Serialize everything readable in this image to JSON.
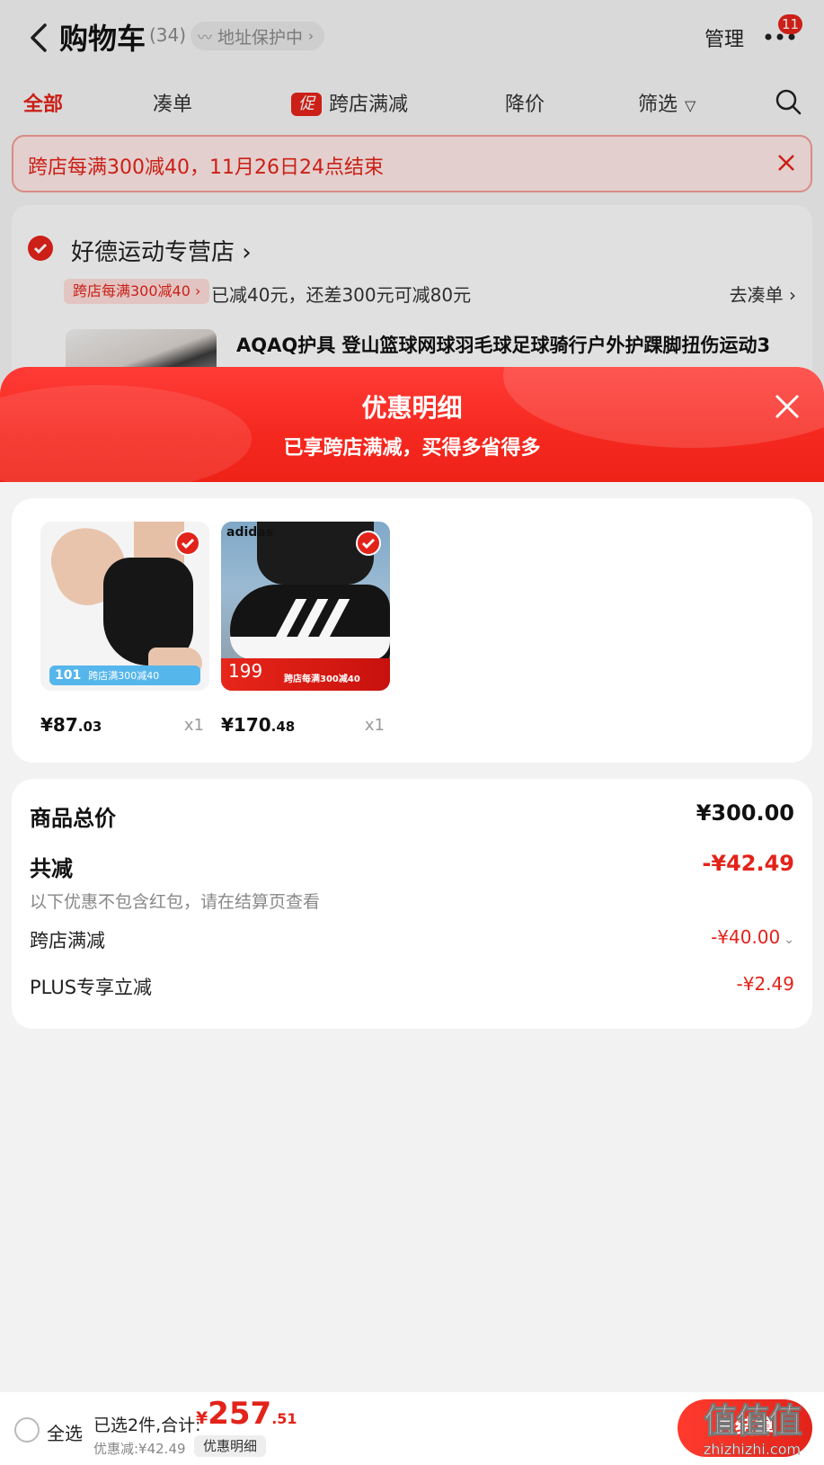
{
  "header": {
    "title": "购物车",
    "count": "(34)",
    "address_label": "地址保护中",
    "manage_label": "管理",
    "more_badge": "11"
  },
  "tabs": {
    "all": "全部",
    "combine": "凑单",
    "promo_icon": "促",
    "cross_store": "跨店满减",
    "price_drop": "降价",
    "filter": "筛选"
  },
  "promo_banner": {
    "text": "跨店每满300减40，11月26日24点结束"
  },
  "store": {
    "name": "好德运动专营店",
    "promo_tag": "跨店每满300减40",
    "promo_desc": "已减40元，还差300元可减80元",
    "goto_label": "去凑单",
    "product_title": "AQAQ护具 登山篮球网球羽毛球足球骑行户外护踝脚扭伤运动3"
  },
  "sheet": {
    "title": "优惠明细",
    "subtitle": "已享跨店满减，买得多省得多"
  },
  "products": [
    {
      "price_int": "¥87",
      "price_dec": ".03",
      "qty": "x1",
      "img_tag_price": "101",
      "img_tag_text": "跨店满300减40",
      "icon": "ankle-brace-image"
    },
    {
      "price_int": "¥170",
      "price_dec": ".48",
      "qty": "x1",
      "brand": "adidas",
      "img_tag_price": "199",
      "img_tag_text": "跨店每满300减40",
      "icon": "sneaker-image"
    }
  ],
  "summary": {
    "total_label": "商品总价",
    "total_value": "¥300.00",
    "reduce_label": "共减",
    "reduce_value": "-¥42.49",
    "note": "以下优惠不包含红包，请在结算页查看",
    "cross_label": "跨店满减",
    "cross_value": "-¥40.00",
    "plus_label": "PLUS专享立减",
    "plus_value": "-¥2.49"
  },
  "bottom": {
    "select_all": "全选",
    "selected_info": "已选2件,合计:",
    "currency": "¥",
    "total_int": "257",
    "total_dec": ".51",
    "discount": "优惠减:¥42.49",
    "detail_chip": "优惠明细",
    "checkout": "去结算",
    "watermark_main": "值值值",
    "watermark_url": "zhizhizhi.com"
  },
  "colors": {
    "accent": "#e2231a",
    "background": "#f2f2f2"
  }
}
